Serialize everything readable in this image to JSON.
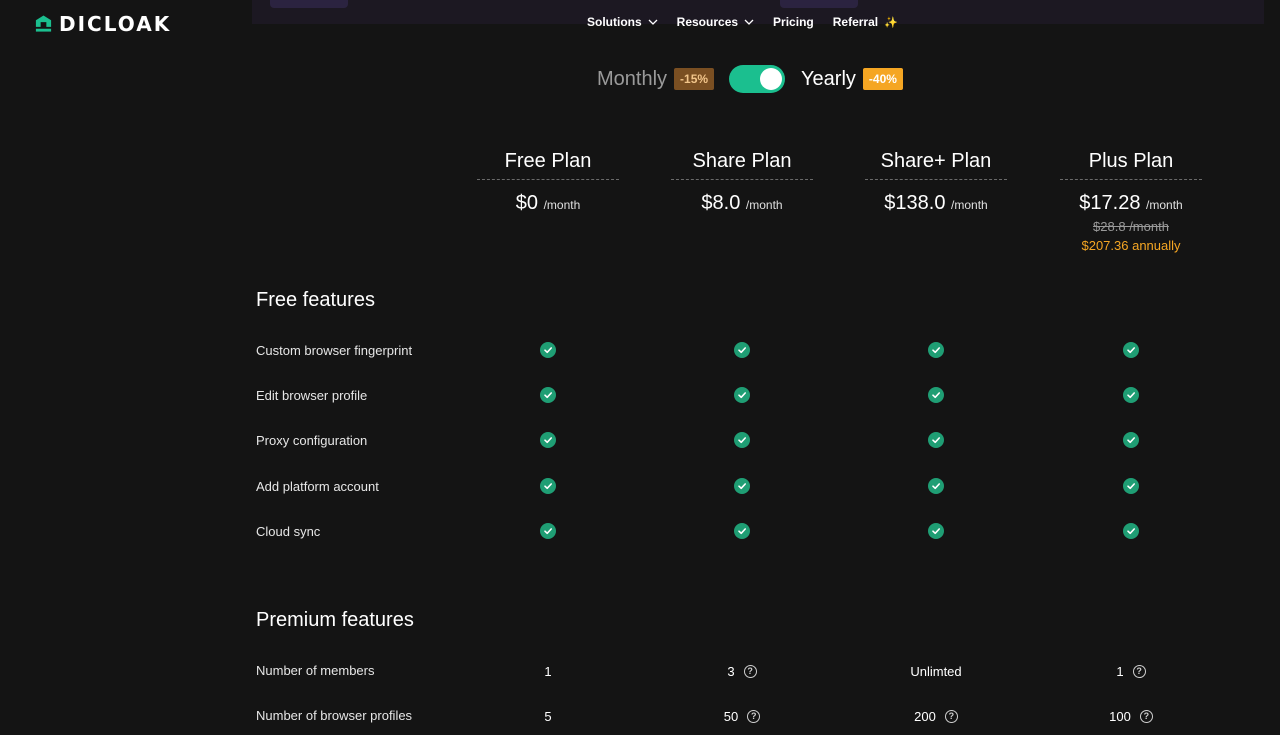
{
  "brand": {
    "name": "DICLOAK",
    "accent": "#1bbf8f"
  },
  "nav": {
    "items": [
      {
        "label": "Solutions",
        "has_dropdown": true
      },
      {
        "label": "Resources",
        "has_dropdown": true
      },
      {
        "label": "Pricing",
        "has_dropdown": false
      },
      {
        "label": "Referral",
        "has_dropdown": false
      }
    ],
    "referral_sparkle": "✨"
  },
  "billing": {
    "monthly_label": "Monthly",
    "monthly_discount": "-15%",
    "yearly_label": "Yearly",
    "yearly_discount": "-40%",
    "selected": "Yearly"
  },
  "plans": [
    {
      "name": "Free Plan",
      "price": "$0",
      "period": "/month",
      "old_price": "",
      "annual": ""
    },
    {
      "name": "Share Plan",
      "price": "$8.0",
      "period": "/month",
      "old_price": "",
      "annual": ""
    },
    {
      "name": "Share+ Plan",
      "price": "$138.0",
      "period": "/month",
      "old_price": "",
      "annual": ""
    },
    {
      "name": "Plus Plan",
      "price": "$17.28",
      "period": "/month",
      "old_price": "$28.8 /month",
      "annual": "$207.36 annually"
    }
  ],
  "free_features": {
    "title": "Free features",
    "rows": [
      {
        "label": "Custom browser fingerprint",
        "values": [
          "check",
          "check",
          "check",
          "check"
        ]
      },
      {
        "label": "Edit browser profile",
        "values": [
          "check",
          "check",
          "check",
          "check"
        ]
      },
      {
        "label": "Proxy configuration",
        "values": [
          "check",
          "check",
          "check",
          "check"
        ]
      },
      {
        "label": "Add platform account",
        "values": [
          "check",
          "check",
          "check",
          "check"
        ]
      },
      {
        "label": "Cloud sync",
        "values": [
          "check",
          "check",
          "check",
          "check"
        ]
      }
    ]
  },
  "premium_features": {
    "title": "Premium features",
    "rows": [
      {
        "label": "Number of members",
        "values": [
          "1",
          "3",
          "Unlimted",
          "1"
        ],
        "help": [
          false,
          true,
          false,
          true
        ]
      },
      {
        "label": "Number of browser profiles",
        "values": [
          "5",
          "50",
          "200",
          "100"
        ],
        "help": [
          false,
          true,
          true,
          true
        ]
      }
    ]
  },
  "help_glyph": "?"
}
